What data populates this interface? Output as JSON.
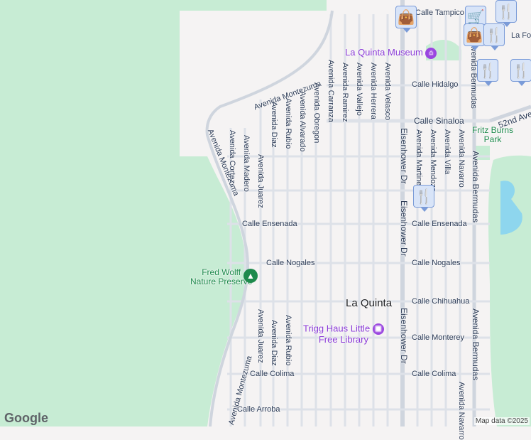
{
  "colors": {
    "park": "#c7ecd4",
    "water": "#8ed6ee",
    "road": "#dde1e8",
    "bg": "#f5f3f3",
    "poi": "#9a45e0"
  },
  "city": "La Quinta",
  "pois": {
    "museum": "La Quinta Museum",
    "library_line1": "Trigg Haus Little",
    "library_line2": "Free Library",
    "preserve_line1": "Fred Wolff",
    "preserve_line2": "Nature Preserve",
    "park_line1": "Fritz Burns",
    "park_line2": "Park"
  },
  "streets": {
    "tampico": "Calle Tampico",
    "fo": "La Fo",
    "hidalgo": "Calle Hidalgo",
    "sinaloa": "Calle Sinaloa",
    "ave52": "52nd Ave",
    "ensenada": "Calle Ensenada",
    "nogales": "Calle Nogales",
    "chihuahua": "Calle Chihuahua",
    "monterey": "Calle Monterey",
    "colima": "Calle Colima",
    "arroba": "Calle Arroba",
    "montezuma": "Avenida Montezuma",
    "cortez": "Avenida Cortez",
    "madero": "Avenida Madero",
    "juarez": "Avenida Juarez",
    "diaz": "Avenida Diaz",
    "rubio": "Avenida Rubio",
    "alvarado": "Avenida Alvarado",
    "obregon": "Avenida Obregon",
    "carranza": "Avenida Carranza",
    "ramirez": "Avenida Ramirez",
    "vallejo": "Avenida Vallejo",
    "herrera": "Avenida Herrera",
    "velasco": "Avenida Velasco",
    "eisenhower": "Eisenhower Dr",
    "martinez": "Avenida Martinez",
    "mendoza": "Avenida Mendoza",
    "villa": "Avenida Villa",
    "navarro": "Avenida Navarro",
    "bermudas": "Avenida Bermudas"
  },
  "markers": [
    {
      "type": "shopping-bag",
      "icon": "👜"
    },
    {
      "type": "restaurant",
      "icon": "🍴"
    },
    {
      "type": "restaurant",
      "icon": "🍴"
    },
    {
      "type": "restaurant",
      "icon": "🍴"
    },
    {
      "type": "shopping-bag",
      "icon": "👜"
    },
    {
      "type": "restaurant",
      "icon": "🍴"
    },
    {
      "type": "shopping-cart",
      "icon": "🛒"
    }
  ],
  "logo": "Google",
  "attribution": "Map data ©2025"
}
